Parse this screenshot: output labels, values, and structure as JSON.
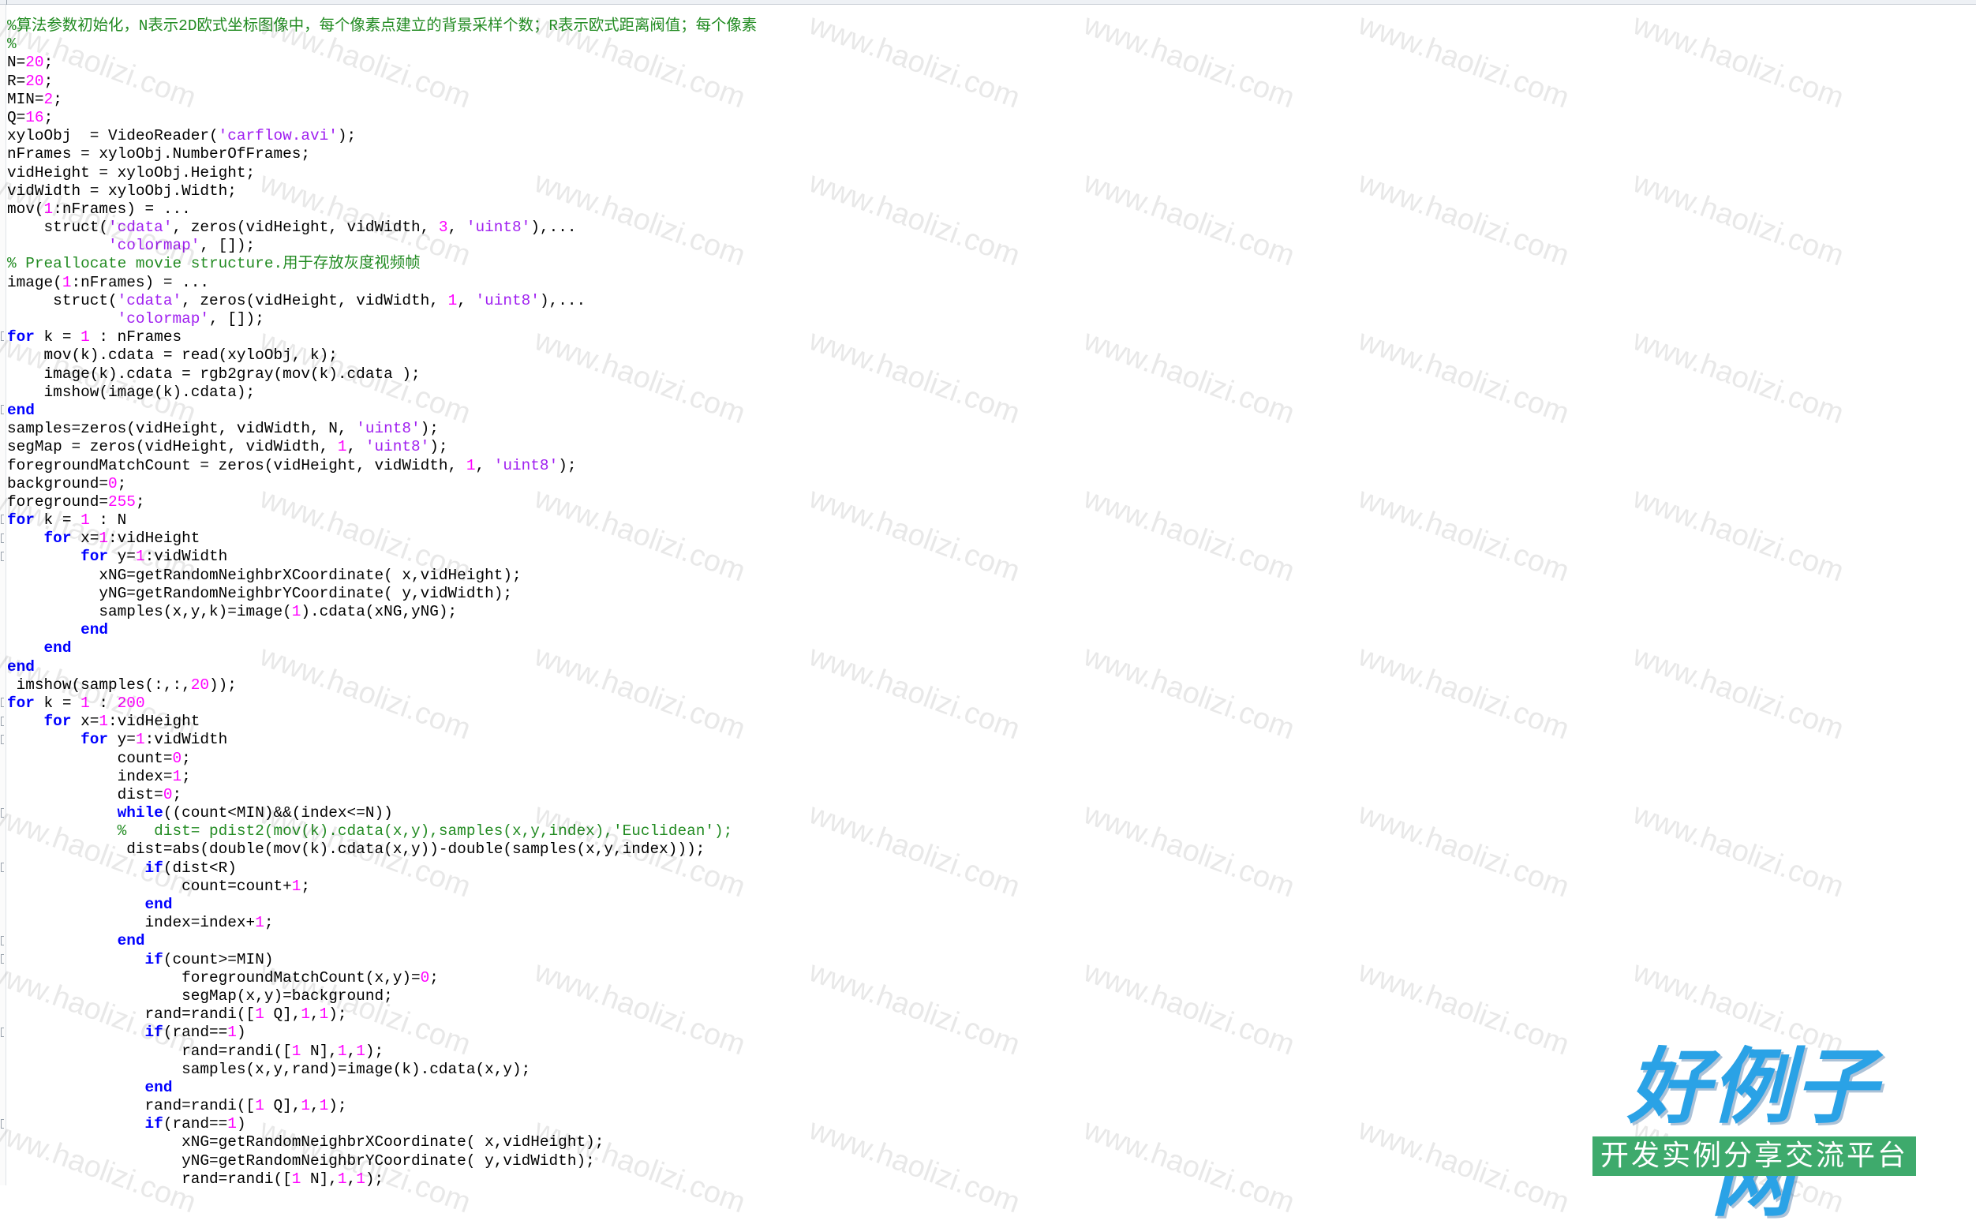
{
  "editor": {
    "lines": [
      [
        [
          "cm",
          "%算法参数初始化，N表示2D欧式坐标图像中，每个像素点建立的背景采样个数；R表示欧式距离阀值；每个像素"
        ]
      ],
      [
        [
          "cm",
          "%"
        ]
      ],
      [
        [
          "pl",
          "N="
        ],
        [
          "num",
          "20"
        ],
        [
          "pl",
          ";"
        ]
      ],
      [
        [
          "pl",
          "R="
        ],
        [
          "num",
          "20"
        ],
        [
          "pl",
          ";"
        ]
      ],
      [
        [
          "pl",
          "MIN="
        ],
        [
          "num",
          "2"
        ],
        [
          "pl",
          ";"
        ]
      ],
      [
        [
          "pl",
          "Q="
        ],
        [
          "num",
          "16"
        ],
        [
          "pl",
          ";"
        ]
      ],
      [
        [
          "pl",
          "xyloObj  = VideoReader("
        ],
        [
          "str",
          "'carflow.avi'"
        ],
        [
          "pl",
          ");"
        ]
      ],
      [
        [
          "pl",
          "nFrames = xyloObj.NumberOfFrames;"
        ]
      ],
      [
        [
          "pl",
          "vidHeight = xyloObj.Height;"
        ]
      ],
      [
        [
          "pl",
          "vidWidth = xyloObj.Width;"
        ]
      ],
      [
        [
          "pl",
          "mov("
        ],
        [
          "num",
          "1"
        ],
        [
          "pl",
          ":nFrames) = ..."
        ]
      ],
      [
        [
          "pl",
          "    struct("
        ],
        [
          "str",
          "'cdata'"
        ],
        [
          "pl",
          ", zeros(vidHeight, vidWidth, "
        ],
        [
          "num",
          "3"
        ],
        [
          "pl",
          ", "
        ],
        [
          "str",
          "'uint8'"
        ],
        [
          "pl",
          "),..."
        ]
      ],
      [
        [
          "pl",
          "           "
        ],
        [
          "str",
          "'colormap'"
        ],
        [
          "pl",
          ", []);"
        ]
      ],
      [
        [
          "cm",
          "% Preallocate movie structure.用于存放灰度视频帧"
        ]
      ],
      [
        [
          "pl",
          "image("
        ],
        [
          "num",
          "1"
        ],
        [
          "pl",
          ":nFrames) = ..."
        ]
      ],
      [
        [
          "pl",
          "     struct("
        ],
        [
          "str",
          "'cdata'"
        ],
        [
          "pl",
          ", zeros(vidHeight, vidWidth, "
        ],
        [
          "num",
          "1"
        ],
        [
          "pl",
          ", "
        ],
        [
          "str",
          "'uint8'"
        ],
        [
          "pl",
          "),..."
        ]
      ],
      [
        [
          "pl",
          "            "
        ],
        [
          "str",
          "'colormap'"
        ],
        [
          "pl",
          ", []);"
        ]
      ],
      [
        [
          "kw",
          "for"
        ],
        [
          "pl",
          " k = "
        ],
        [
          "num",
          "1"
        ],
        [
          "pl",
          " : nFrames"
        ]
      ],
      [
        [
          "pl",
          "    mov(k).cdata = read(xyloObj, k);"
        ]
      ],
      [
        [
          "pl",
          "    image(k).cdata = rgb2gray(mov(k).cdata );"
        ]
      ],
      [
        [
          "pl",
          "    imshow(image(k).cdata);"
        ]
      ],
      [
        [
          "kw",
          "end"
        ]
      ],
      [
        [
          "pl",
          "samples=zeros(vidHeight, vidWidth, N, "
        ],
        [
          "str",
          "'uint8'"
        ],
        [
          "pl",
          ");"
        ]
      ],
      [
        [
          "pl",
          "segMap = zeros(vidHeight, vidWidth, "
        ],
        [
          "num",
          "1"
        ],
        [
          "pl",
          ", "
        ],
        [
          "str",
          "'uint8'"
        ],
        [
          "pl",
          ");"
        ]
      ],
      [
        [
          "pl",
          "foregroundMatchCount = zeros(vidHeight, vidWidth, "
        ],
        [
          "num",
          "1"
        ],
        [
          "pl",
          ", "
        ],
        [
          "str",
          "'uint8'"
        ],
        [
          "pl",
          ");"
        ]
      ],
      [
        [
          "pl",
          "background="
        ],
        [
          "num",
          "0"
        ],
        [
          "pl",
          ";"
        ]
      ],
      [
        [
          "pl",
          "foreground="
        ],
        [
          "num",
          "255"
        ],
        [
          "pl",
          ";"
        ]
      ],
      [
        [
          "kw",
          "for"
        ],
        [
          "pl",
          " k = "
        ],
        [
          "num",
          "1"
        ],
        [
          "pl",
          " : N"
        ]
      ],
      [
        [
          "pl",
          "    "
        ],
        [
          "kw",
          "for"
        ],
        [
          "pl",
          " x="
        ],
        [
          "num",
          "1"
        ],
        [
          "pl",
          ":vidHeight"
        ]
      ],
      [
        [
          "pl",
          "        "
        ],
        [
          "kw",
          "for"
        ],
        [
          "pl",
          " y="
        ],
        [
          "num",
          "1"
        ],
        [
          "pl",
          ":vidWidth"
        ]
      ],
      [
        [
          "pl",
          "          xNG=getRandomNeighbrXCoordinate( x,vidHeight);"
        ]
      ],
      [
        [
          "pl",
          "          yNG=getRandomNeighbrYCoordinate( y,vidWidth);"
        ]
      ],
      [
        [
          "pl",
          "          samples(x,y,k)=image("
        ],
        [
          "num",
          "1"
        ],
        [
          "pl",
          ").cdata(xNG,yNG);"
        ]
      ],
      [
        [
          "pl",
          "        "
        ],
        [
          "kw",
          "end"
        ]
      ],
      [
        [
          "pl",
          "    "
        ],
        [
          "kw",
          "end"
        ]
      ],
      [
        [
          "kw",
          "end"
        ]
      ],
      [
        [
          "pl",
          " imshow(samples(:,:,"
        ],
        [
          "num",
          "20"
        ],
        [
          "pl",
          "));"
        ]
      ],
      [
        [
          "kw",
          "for"
        ],
        [
          "pl",
          " k = "
        ],
        [
          "num",
          "1"
        ],
        [
          "pl",
          " : "
        ],
        [
          "num",
          "200"
        ]
      ],
      [
        [
          "pl",
          "    "
        ],
        [
          "kw",
          "for"
        ],
        [
          "pl",
          " x="
        ],
        [
          "num",
          "1"
        ],
        [
          "pl",
          ":vidHeight"
        ]
      ],
      [
        [
          "pl",
          "        "
        ],
        [
          "kw",
          "for"
        ],
        [
          "pl",
          " y="
        ],
        [
          "num",
          "1"
        ],
        [
          "pl",
          ":vidWidth"
        ]
      ],
      [
        [
          "pl",
          "            count="
        ],
        [
          "num",
          "0"
        ],
        [
          "pl",
          ";"
        ]
      ],
      [
        [
          "pl",
          "            index="
        ],
        [
          "num",
          "1"
        ],
        [
          "pl",
          ";"
        ]
      ],
      [
        [
          "pl",
          "            dist="
        ],
        [
          "num",
          "0"
        ],
        [
          "pl",
          ";"
        ]
      ],
      [
        [
          "pl",
          "            "
        ],
        [
          "kw",
          "while"
        ],
        [
          "pl",
          "((count<MIN)&&(index<=N))"
        ]
      ],
      [
        [
          "pl",
          "            "
        ],
        [
          "cm",
          "%   dist= pdist2(mov(k).cdata(x,y),samples(x,y,index),'Euclidean');"
        ]
      ],
      [
        [
          "pl",
          "             dist=abs(double(mov(k).cdata(x,y))-double(samples(x,y,index)));"
        ]
      ],
      [
        [
          "pl",
          "               "
        ],
        [
          "kw",
          "if"
        ],
        [
          "pl",
          "(dist<R)"
        ]
      ],
      [
        [
          "pl",
          "                   count=count+"
        ],
        [
          "num",
          "1"
        ],
        [
          "pl",
          ";"
        ]
      ],
      [
        [
          "pl",
          "               "
        ],
        [
          "kw",
          "end"
        ]
      ],
      [
        [
          "pl",
          "               index=index+"
        ],
        [
          "num",
          "1"
        ],
        [
          "pl",
          ";"
        ]
      ],
      [
        [
          "pl",
          "            "
        ],
        [
          "kw",
          "end"
        ]
      ],
      [
        [
          "pl",
          "               "
        ],
        [
          "kw",
          "if"
        ],
        [
          "pl",
          "(count>=MIN)"
        ]
      ],
      [
        [
          "pl",
          "                   foregroundMatchCount(x,y)="
        ],
        [
          "num",
          "0"
        ],
        [
          "pl",
          ";"
        ]
      ],
      [
        [
          "pl",
          "                   segMap(x,y)=background;"
        ]
      ],
      [
        [
          "pl",
          "               rand=randi(["
        ],
        [
          "num",
          "1"
        ],
        [
          "pl",
          " Q],"
        ],
        [
          "num",
          "1"
        ],
        [
          "pl",
          ","
        ],
        [
          "num",
          "1"
        ],
        [
          "pl",
          ");"
        ]
      ],
      [
        [
          "pl",
          "               "
        ],
        [
          "kw",
          "if"
        ],
        [
          "pl",
          "(rand=="
        ],
        [
          "num",
          "1"
        ],
        [
          "pl",
          ")"
        ]
      ],
      [
        [
          "pl",
          "                   rand=randi(["
        ],
        [
          "num",
          "1"
        ],
        [
          "pl",
          " N],"
        ],
        [
          "num",
          "1"
        ],
        [
          "pl",
          ","
        ],
        [
          "num",
          "1"
        ],
        [
          "pl",
          ");"
        ]
      ],
      [
        [
          "pl",
          "                   samples(x,y,rand)=image(k).cdata(x,y);"
        ]
      ],
      [
        [
          "pl",
          "               "
        ],
        [
          "kw",
          "end"
        ]
      ],
      [
        [
          "pl",
          "               rand=randi(["
        ],
        [
          "num",
          "1"
        ],
        [
          "pl",
          " Q],"
        ],
        [
          "num",
          "1"
        ],
        [
          "pl",
          ","
        ],
        [
          "num",
          "1"
        ],
        [
          "pl",
          ");"
        ]
      ],
      [
        [
          "pl",
          "               "
        ],
        [
          "kw",
          "if"
        ],
        [
          "pl",
          "(rand=="
        ],
        [
          "num",
          "1"
        ],
        [
          "pl",
          ")"
        ]
      ],
      [
        [
          "pl",
          "                   xNG=getRandomNeighbrXCoordinate( x,vidHeight);"
        ]
      ],
      [
        [
          "pl",
          "                   yNG=getRandomNeighbrYCoordinate( y,vidWidth);"
        ]
      ],
      [
        [
          "pl",
          "                   rand=randi(["
        ],
        [
          "num",
          "1"
        ],
        [
          "pl",
          " N],"
        ],
        [
          "num",
          "1"
        ],
        [
          "pl",
          ","
        ],
        [
          "num",
          "1"
        ],
        [
          "pl",
          ");"
        ]
      ]
    ],
    "fold_markers_at_lines": [
      17,
      21,
      27,
      28,
      29,
      37,
      38,
      39,
      43,
      46,
      50,
      51,
      55,
      60
    ]
  },
  "watermark": {
    "text": "www.haolizi.com"
  },
  "logo": {
    "title": "好例子网",
    "subtitle": "开发实例分享交流平台"
  },
  "colors": {
    "comment": "#228B22",
    "keyword": "#0000FF",
    "number": "#FF00FF",
    "string": "#A020F0",
    "logo_blue": "#2aa2e6",
    "logo_green": "#3eaa6c"
  }
}
